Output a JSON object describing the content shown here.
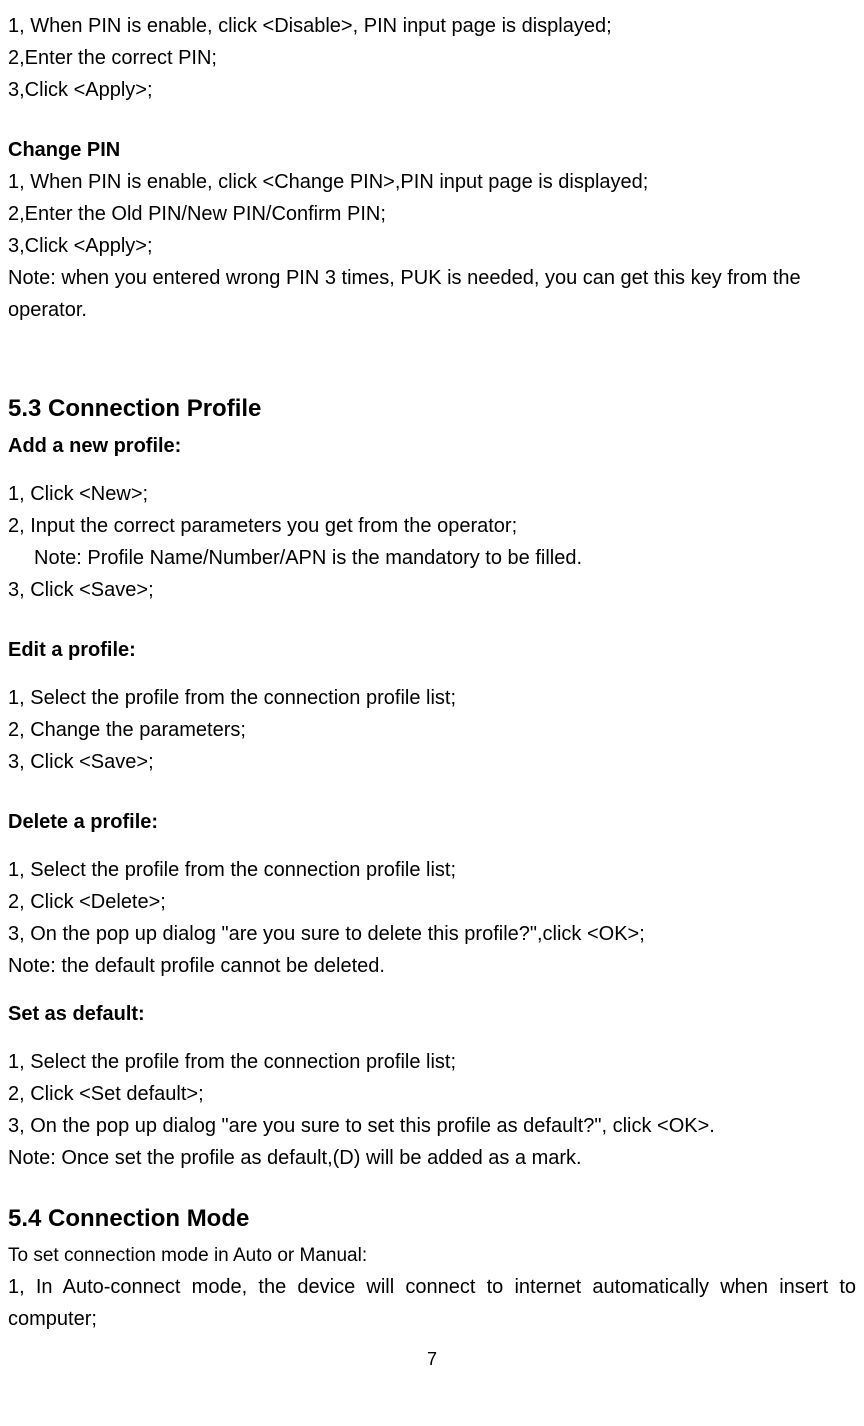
{
  "pin_disable": {
    "step1": "1, When PIN is enable, click <Disable>, PIN input page is displayed;",
    "step2": "2,Enter the correct PIN;",
    "step3": "3,Click <Apply>;"
  },
  "change_pin": {
    "title": "Change PIN",
    "step1": "1, When PIN is enable, click <Change PIN>,PIN input page is displayed;",
    "step2": "2,Enter the Old PIN/New PIN/Confirm PIN;",
    "step3": "3,Click <Apply>;",
    "note": "Note: when you entered wrong PIN 3 times, PUK is needed, you can get this key from the operator."
  },
  "connection_profile": {
    "heading": "5.3 Connection Profile",
    "add": {
      "title": "Add a new profile:",
      "step1": "1, Click <New>;",
      "step2": "2, Input the correct parameters you get from the operator;",
      "note": "Note: Profile Name/Number/APN is the mandatory to be filled.",
      "step3": "3, Click <Save>;"
    },
    "edit": {
      "title": "Edit a profile:",
      "step1": "1, Select the profile from the connection profile list;",
      "step2": "2, Change the parameters;",
      "step3": "3, Click <Save>;"
    },
    "delete": {
      "title": "Delete a profile:",
      "step1": "1, Select the profile from the connection profile list;",
      "step2": "2, Click <Delete>;",
      "step3": "3, On the pop up dialog \"are you sure to delete this profile?\",click <OK>;",
      "note": "Note: the default profile cannot be deleted."
    },
    "default": {
      "title": "Set as default:",
      "step1": "1, Select the profile from the connection profile list;",
      "step2": "2, Click <Set default>;",
      "step3": "3, On the pop up dialog \"are you sure to set this profile as default?\", click <OK>.",
      "note": "Note: Once set the profile as default,(D) will be added as a mark."
    }
  },
  "connection_mode": {
    "heading": "5.4 Connection Mode",
    "intro": "To set connection mode in Auto or Manual:",
    "step1": "1, In Auto-connect mode, the device will connect to internet automatically when insert to computer;"
  },
  "page_number": "7"
}
